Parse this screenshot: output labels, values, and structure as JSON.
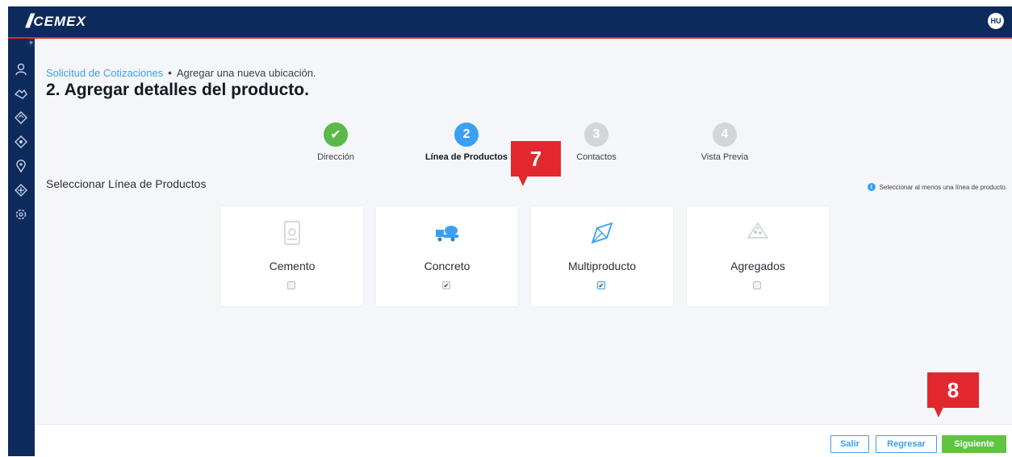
{
  "header": {
    "logo_text": "CEMEX",
    "avatar": "HU"
  },
  "sidebar": {
    "toggle": "»",
    "icons": [
      "user-icon",
      "handshake-icon",
      "diamond-icon",
      "tag-icon",
      "location-pin-icon",
      "handshake-icon",
      "settings-icon"
    ]
  },
  "breadcrumb": {
    "link": "Solicitud de Cotizaciones",
    "separator": "•",
    "current": "Agregar una nueva ubicación."
  },
  "page_title": "2. Agregar detalles del producto.",
  "steps": [
    {
      "number": "✔",
      "label": "Dirección",
      "state": "done",
      "color": "#5bb84a"
    },
    {
      "number": "2",
      "label": "Línea de Productos",
      "state": "active",
      "color": "#3aa0f3"
    },
    {
      "number": "3",
      "label": "Contactos",
      "state": "pending",
      "color": "#d2d5da"
    },
    {
      "number": "4",
      "label": "Vista Previa",
      "state": "pending",
      "color": "#d2d5da"
    }
  ],
  "section_title": "Seleccionar Línea de Productos",
  "hint": {
    "icon": "i",
    "text": "Seleccionar al menos una línea de producto."
  },
  "products": [
    {
      "name": "Cemento",
      "icon": "cement-bag-icon",
      "checked": false,
      "check_mark": ""
    },
    {
      "name": "Concreto",
      "icon": "concrete-truck-icon",
      "checked": true,
      "check_mark": "✔"
    },
    {
      "name": "Multiproducto",
      "icon": "multiproduct-icon",
      "checked": true,
      "check_mark": "✔"
    },
    {
      "name": "Agregados",
      "icon": "aggregates-icon",
      "checked": false,
      "check_mark": ""
    }
  ],
  "badges": [
    "7",
    "8"
  ],
  "footer": {
    "exit": "Salir",
    "back": "Regresar",
    "next": "Siguiente"
  },
  "colors": {
    "navy": "#0d2a5c",
    "red": "#e2282e",
    "blue": "#3aa0f3",
    "green": "#5ec442"
  }
}
